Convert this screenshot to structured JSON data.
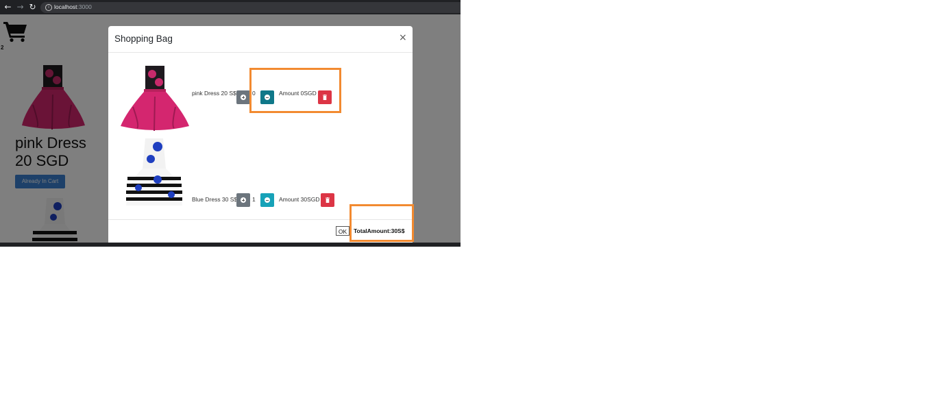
{
  "browser": {
    "url_host": "localhost",
    "url_port": ":3000"
  },
  "page": {
    "cart_count": "2",
    "product_title": "pink Dress 20 SGD",
    "product_button": "Already In Cart"
  },
  "modal": {
    "title": "Shopping Bag",
    "close_label": "×",
    "items": [
      {
        "name": "pink Dress 20 S$",
        "quantity": "0",
        "amount": "Amount 0SGD",
        "image": "pink-dress-image"
      },
      {
        "name": "Blue Dress 30 S$",
        "quantity": "1",
        "amount": "Amount 30SGD",
        "image": "blue-dress-image"
      }
    ],
    "ok_label": "OK",
    "total": "TotalAmount:30S$"
  },
  "colors": {
    "highlight": "#f28a30",
    "plus_button": "#6c757d",
    "minus_button": "#17a2b8",
    "delete_button": "#dc3545",
    "primary_button": "#3a80d2"
  }
}
